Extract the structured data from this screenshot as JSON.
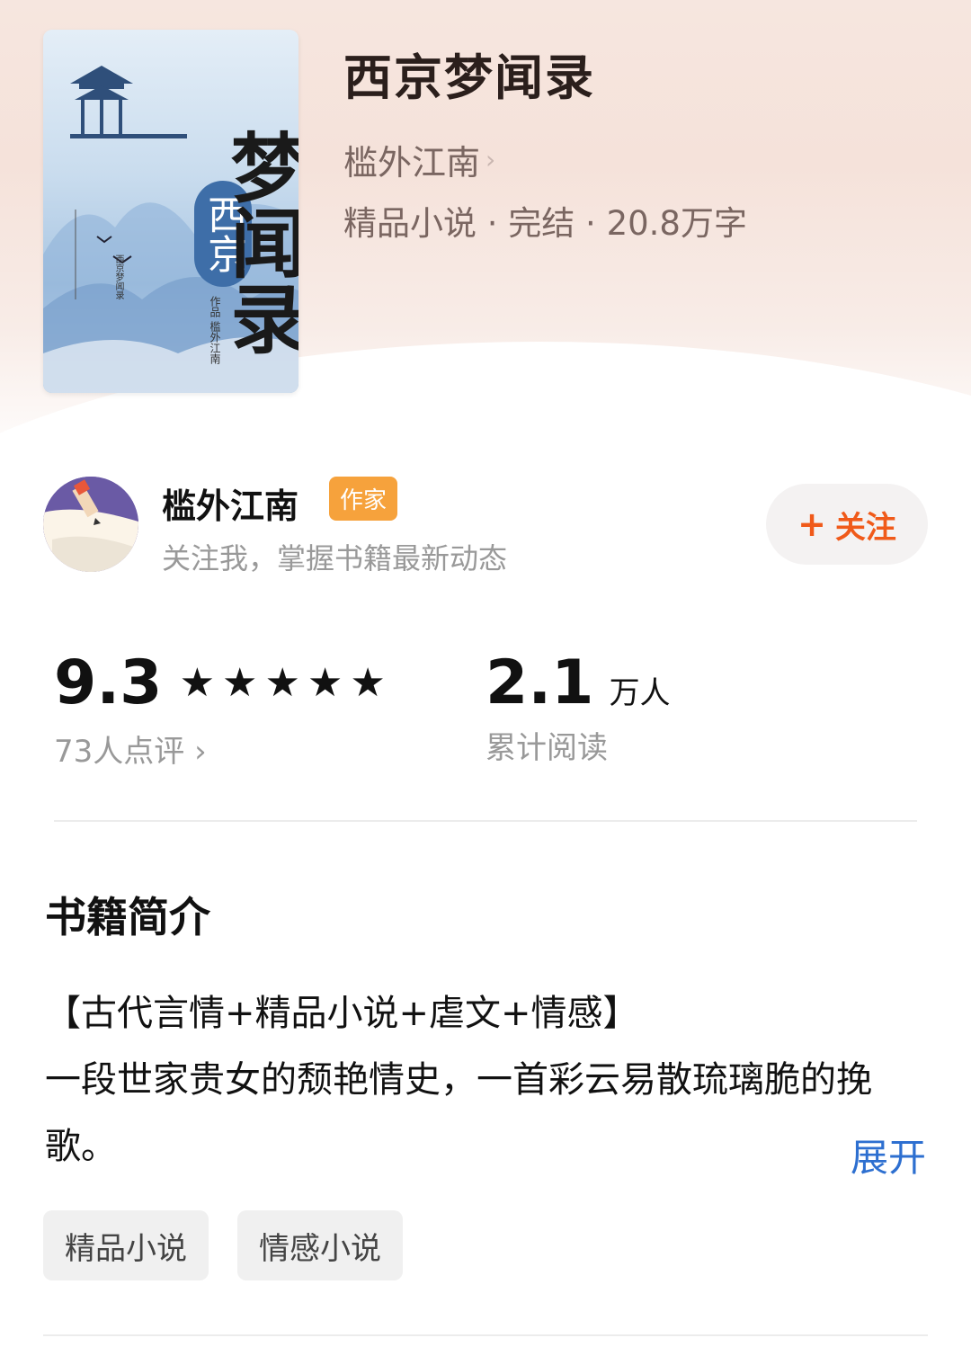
{
  "book": {
    "title": "西京梦闻录",
    "author": "槛外江南",
    "meta": "精品小说 · 完结 · 20.8万字",
    "cover": {
      "title": "梦闻录",
      "subtitle": "西京",
      "author_vertical": "作品 槛外江南",
      "side_vertical": "西京梦闻录"
    }
  },
  "author_card": {
    "name": "槛外江南",
    "badge": "作家",
    "desc": "关注我，掌握书籍最新动态",
    "follow_label": "关注",
    "follow_icon": "plus-icon"
  },
  "stats": {
    "rating": "9.3",
    "stars": "★★★★★",
    "star_count": 5,
    "reviews": "73人点评",
    "reads_value": "2.1",
    "reads_unit": "万人",
    "reads_label": "累计阅读"
  },
  "intro": {
    "heading": "书籍简介",
    "tags_line": "【古代言情+精品小说+虐文+情感】",
    "body": "一段世家贵女的颓艳情史，一首彩云易散琉璃脆的挽歌。",
    "expand_label": "展开"
  },
  "tags": [
    "精品小说",
    "情感小说"
  ],
  "colors": {
    "accent": "#f05a1a",
    "badge": "#f6a23c",
    "link": "#2d6fd0",
    "muted": "#999999"
  }
}
